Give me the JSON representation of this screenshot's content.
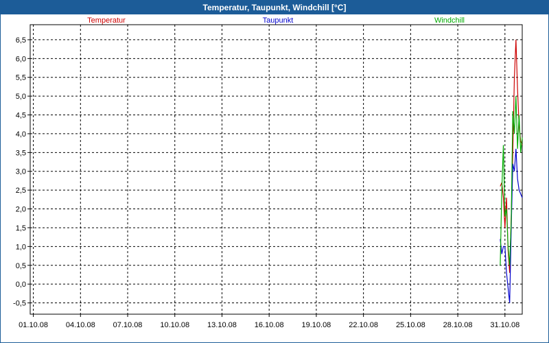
{
  "window": {
    "title": "Temperatur, Taupunkt, Windchill [°C]"
  },
  "colors": {
    "titlebar": "#1c5c98",
    "temperatur": "#cc0000",
    "taupunkt": "#0000cc",
    "windchill": "#00aa00",
    "grid": "#000000"
  },
  "chart_data": {
    "type": "line",
    "title": "Temperatur, Taupunkt, Windchill [°C]",
    "xlabel": "",
    "ylabel": "",
    "x_ticks": [
      "01.10.08",
      "04.10.08",
      "07.10.08",
      "10.10.08",
      "13.10.08",
      "16.10.08",
      "19.10.08",
      "22.10.08",
      "25.10.08",
      "28.10.08",
      "31.10.08"
    ],
    "y_ticks": [
      "-0,5",
      "0,0",
      "0,5",
      "1,0",
      "1,5",
      "2,0",
      "2,5",
      "3,0",
      "3,5",
      "4,0",
      "4,5",
      "5,0",
      "5,5",
      "6,0",
      "6,5"
    ],
    "xlim": [
      0,
      31.3
    ],
    "ylim": [
      -0.8,
      6.9
    ],
    "grid": true,
    "legend_position": "top",
    "series": [
      {
        "name": "Temperatur",
        "color": "#cc0000",
        "x": [
          29.9,
          30.0,
          30.1,
          30.2,
          30.3,
          30.4,
          30.5,
          30.6,
          30.7,
          30.8,
          30.9,
          31.0,
          31.1,
          31.2,
          31.3
        ],
        "values": [
          2.6,
          2.7,
          2.3,
          1.5,
          2.3,
          0.9,
          0.3,
          1.8,
          3.5,
          5.5,
          6.5,
          5.2,
          4.2,
          3.8,
          3.7
        ]
      },
      {
        "name": "Taupunkt",
        "color": "#0000cc",
        "x": [
          29.9,
          30.0,
          30.1,
          30.2,
          30.3,
          30.4,
          30.5,
          30.6,
          30.7,
          30.8,
          30.9,
          31.0,
          31.1,
          31.2,
          31.3
        ],
        "values": [
          1.2,
          0.8,
          1.0,
          1.0,
          0.3,
          -0.1,
          -0.5,
          1.5,
          3.2,
          3.0,
          3.6,
          2.8,
          2.5,
          2.4,
          2.3
        ]
      },
      {
        "name": "Windchill",
        "color": "#00aa00",
        "x": [
          29.9,
          30.0,
          30.1,
          30.2,
          30.3,
          30.4,
          30.5,
          30.6,
          30.7,
          30.8,
          30.9,
          31.0,
          31.1,
          31.2,
          31.3
        ],
        "values": [
          0.5,
          2.5,
          3.7,
          1.8,
          2.0,
          1.0,
          0.5,
          1.7,
          4.6,
          4.0,
          5.0,
          3.6,
          4.5,
          3.5,
          3.9
        ]
      }
    ]
  }
}
